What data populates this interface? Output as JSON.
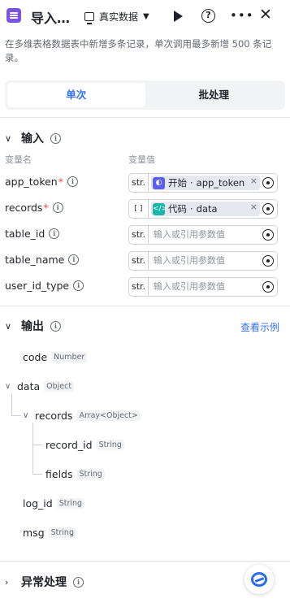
{
  "header": {
    "title": "导入…",
    "mode_label": "真实数据",
    "icons": [
      "app-icon",
      "monitor-icon",
      "caret-down-icon",
      "play-icon",
      "help-icon",
      "more-icon",
      "close-icon"
    ]
  },
  "description": "在多维表格数据表中新增多条记录，单次调用最多新增 500 条记录。",
  "tabs": [
    {
      "label": "单次",
      "active": true
    },
    {
      "label": "批处理",
      "active": false
    }
  ],
  "input": {
    "title": "输入",
    "col_name": "变量名",
    "col_value": "变量值",
    "rows": [
      {
        "name": "app_token",
        "required": true,
        "type": "str.",
        "ref_source": "开始",
        "ref_dot": "·",
        "ref_field": "app_token"
      },
      {
        "name": "records",
        "required": true,
        "type": "[ ]",
        "ref_source": "代码",
        "ref_dot": "·",
        "ref_field": "data"
      },
      {
        "name": "table_id",
        "required": false,
        "type": "str.",
        "placeholder": "输入或引用参数值"
      },
      {
        "name": "table_name",
        "required": false,
        "type": "str.",
        "placeholder": "输入或引用参数值"
      },
      {
        "name": "user_id_type",
        "required": false,
        "type": "str.",
        "placeholder": "输入或引用参数值"
      }
    ]
  },
  "output": {
    "title": "输出",
    "view_example": "查看示例",
    "items": [
      {
        "name": "code",
        "type": "Number"
      },
      {
        "name": "data",
        "type": "Object"
      },
      {
        "name": "records",
        "type": "Array<Object>"
      },
      {
        "name": "record_id",
        "type": "String"
      },
      {
        "name": "fields",
        "type": "String"
      },
      {
        "name": "log_id",
        "type": "String"
      },
      {
        "name": "msg",
        "type": "String"
      }
    ]
  },
  "exception": {
    "title": "异常处理"
  },
  "colors": {
    "accent": "#3370ff",
    "start_chip": "#5b5ef0",
    "code_chip": "#18b5a8",
    "required": "#f54a45"
  }
}
